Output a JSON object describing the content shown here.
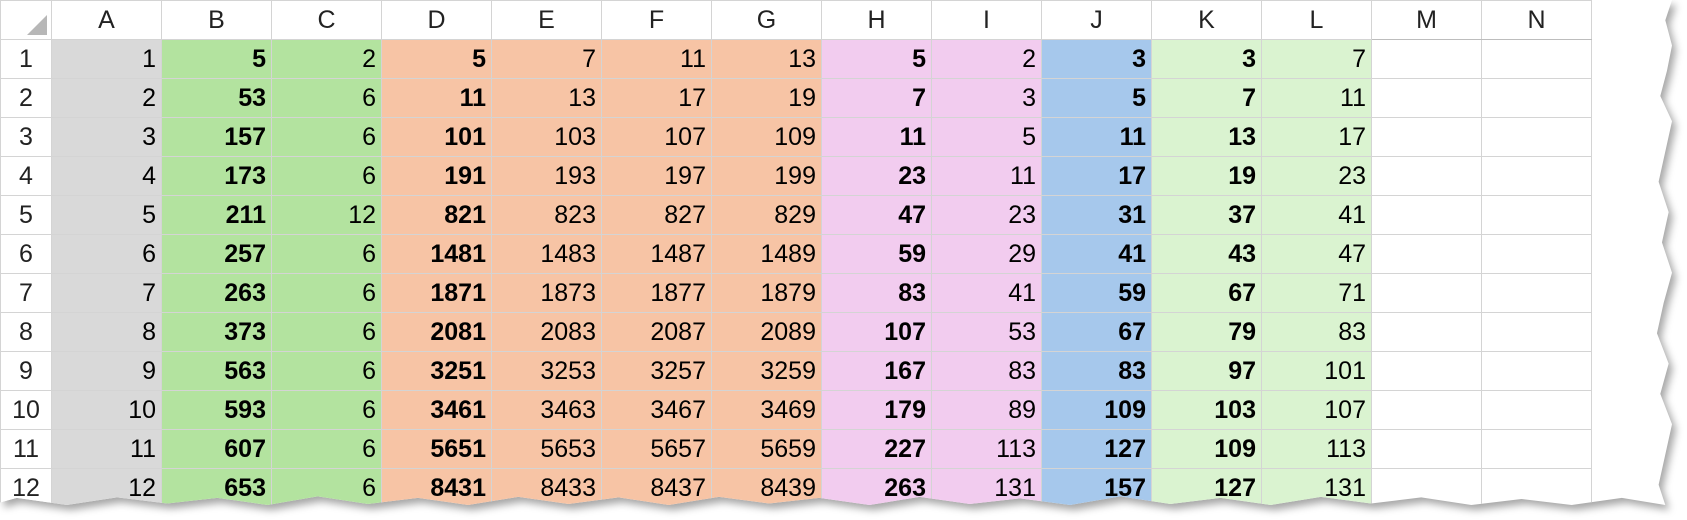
{
  "columns": [
    "A",
    "B",
    "C",
    "D",
    "E",
    "F",
    "G",
    "H",
    "I",
    "J",
    "K",
    "L",
    "M",
    "N"
  ],
  "colors": {
    "A": "#d9d9d9",
    "B": "#b3e39f",
    "C": "#b3e39f",
    "D": "#f7c4a5",
    "E": "#f7c4a5",
    "F": "#f7c4a5",
    "G": "#f7c4a5",
    "H": "#f2ccef",
    "I": "#f2ccef",
    "J": "#a6c8ec",
    "K": "#daf3d0",
    "L": "#daf3d0"
  },
  "rows": [
    {
      "num": "1",
      "cells": [
        "1",
        "5",
        "2",
        "5",
        "7",
        "11",
        "13",
        "5",
        "2",
        "3",
        "3",
        "7"
      ]
    },
    {
      "num": "2",
      "cells": [
        "2",
        "53",
        "6",
        "11",
        "13",
        "17",
        "19",
        "7",
        "3",
        "5",
        "7",
        "11"
      ]
    },
    {
      "num": "3",
      "cells": [
        "3",
        "157",
        "6",
        "101",
        "103",
        "107",
        "109",
        "11",
        "5",
        "11",
        "13",
        "17"
      ]
    },
    {
      "num": "4",
      "cells": [
        "4",
        "173",
        "6",
        "191",
        "193",
        "197",
        "199",
        "23",
        "11",
        "17",
        "19",
        "23"
      ]
    },
    {
      "num": "5",
      "cells": [
        "5",
        "211",
        "12",
        "821",
        "823",
        "827",
        "829",
        "47",
        "23",
        "31",
        "37",
        "41"
      ]
    },
    {
      "num": "6",
      "cells": [
        "6",
        "257",
        "6",
        "1481",
        "1483",
        "1487",
        "1489",
        "59",
        "29",
        "41",
        "43",
        "47"
      ]
    },
    {
      "num": "7",
      "cells": [
        "7",
        "263",
        "6",
        "1871",
        "1873",
        "1877",
        "1879",
        "83",
        "41",
        "59",
        "67",
        "71"
      ]
    },
    {
      "num": "8",
      "cells": [
        "8",
        "373",
        "6",
        "2081",
        "2083",
        "2087",
        "2089",
        "107",
        "53",
        "67",
        "79",
        "83"
      ]
    },
    {
      "num": "9",
      "cells": [
        "9",
        "563",
        "6",
        "3251",
        "3253",
        "3257",
        "3259",
        "167",
        "83",
        "83",
        "97",
        "101"
      ]
    },
    {
      "num": "10",
      "cells": [
        "10",
        "593",
        "6",
        "3461",
        "3463",
        "3467",
        "3469",
        "179",
        "89",
        "109",
        "103",
        "107"
      ]
    },
    {
      "num": "11",
      "cells": [
        "11",
        "607",
        "6",
        "5651",
        "5653",
        "5657",
        "5659",
        "227",
        "113",
        "127",
        "109",
        "113"
      ]
    },
    {
      "num": "12",
      "cells": [
        "12",
        "653",
        "6",
        "8431",
        "8433",
        "8437",
        "8439",
        "263",
        "131",
        "157",
        "127",
        "131"
      ]
    }
  ]
}
